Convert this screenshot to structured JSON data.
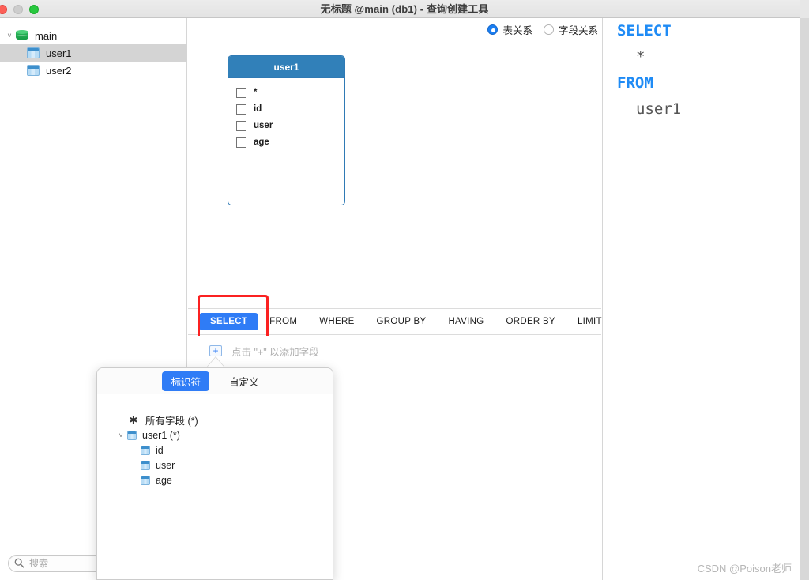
{
  "window": {
    "title": "无标题 @main (db1) - 查询创建工具",
    "traffic_lights": [
      "close",
      "minimize",
      "maximize"
    ]
  },
  "sidebar": {
    "tree": [
      {
        "label": "main",
        "icon": "database-icon",
        "level": 0,
        "expanded": true,
        "selected": false
      },
      {
        "label": "user1",
        "icon": "table-icon",
        "level": 1,
        "expanded": null,
        "selected": true
      },
      {
        "label": "user2",
        "icon": "table-icon",
        "level": 1,
        "expanded": null,
        "selected": false
      }
    ],
    "search": {
      "placeholder": "搜索",
      "value": "",
      "icon": "search-icon"
    }
  },
  "canvas": {
    "relation_modes": [
      {
        "label": "表关系",
        "selected": true
      },
      {
        "label": "字段关系",
        "selected": false
      }
    ],
    "nodes": [
      {
        "title": "user1",
        "fields": [
          {
            "label": "*",
            "checked": false
          },
          {
            "label": "id",
            "checked": false
          },
          {
            "label": "user",
            "checked": false
          },
          {
            "label": "age",
            "checked": false
          }
        ]
      }
    ]
  },
  "clause_bar": {
    "tabs": [
      {
        "label": "SELECT",
        "active": true
      },
      {
        "label": "FROM",
        "active": false
      },
      {
        "label": "WHERE",
        "active": false
      },
      {
        "label": "GROUP BY",
        "active": false
      },
      {
        "label": "HAVING",
        "active": false
      },
      {
        "label": "ORDER BY",
        "active": false
      },
      {
        "label": "LIMIT",
        "active": false
      }
    ],
    "annotation_color": "#fb2121"
  },
  "add_field_row": {
    "plus_label": "+",
    "hint": "点击 \"+\" 以添加字段"
  },
  "popup": {
    "tabs": [
      {
        "label": "标识符",
        "active": true
      },
      {
        "label": "自定义",
        "active": false
      }
    ],
    "tree": [
      {
        "label": "所有字段 (*)",
        "icon": "asterisk-icon",
        "level": 0,
        "expanded": null
      },
      {
        "label": "user1 (*)",
        "icon": "table-icon",
        "level": 0,
        "expanded": true
      },
      {
        "label": "id",
        "icon": "column-icon",
        "level": 1,
        "expanded": null
      },
      {
        "label": "user",
        "icon": "column-icon",
        "level": 1,
        "expanded": null
      },
      {
        "label": "age",
        "icon": "column-icon",
        "level": 1,
        "expanded": null
      }
    ]
  },
  "sql_preview": {
    "lines": [
      {
        "text": "SELECT",
        "kind": "keyword"
      },
      {
        "text": "*",
        "kind": "value"
      },
      {
        "text": "FROM",
        "kind": "keyword"
      },
      {
        "text": "user1",
        "kind": "value"
      }
    ],
    "keyword_color": "#1f8bf5",
    "value_color": "#555555"
  },
  "watermark": {
    "text": "CSDN @Poison老师"
  }
}
